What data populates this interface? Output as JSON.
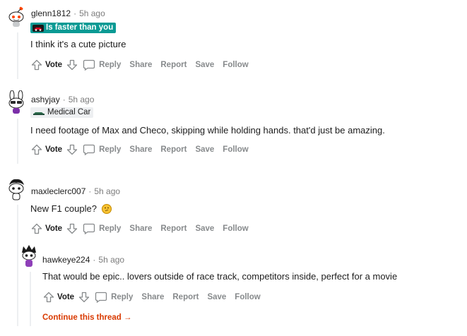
{
  "comments": [
    {
      "username": "glenn1812",
      "time": "5h ago",
      "flair": "Is faster than you",
      "body": "I think it's a cute picture"
    },
    {
      "username": "ashyjay",
      "time": "5h ago",
      "flair": "Medical Car",
      "body": "I need footage of Max and Checo, skipping while holding hands. that'd just be amazing."
    },
    {
      "username": "maxleclerc007",
      "time": "5h ago",
      "flair": "",
      "body": "New F1 couple?"
    },
    {
      "username": "hawkeye224",
      "time": "5h ago",
      "flair": "",
      "body": "That would be epic.. lovers outside of race track, competitors inside, perfect for a movie"
    }
  ],
  "actions": {
    "vote": "Vote",
    "reply": "Reply",
    "share": "Share",
    "report": "Report",
    "save": "Save",
    "follow": "Follow"
  },
  "continue_thread": "Continue this thread",
  "colors": {
    "flair_teal": "#0a9a94",
    "continue_link": "#d93a00",
    "thread_line": "#edeff1"
  }
}
